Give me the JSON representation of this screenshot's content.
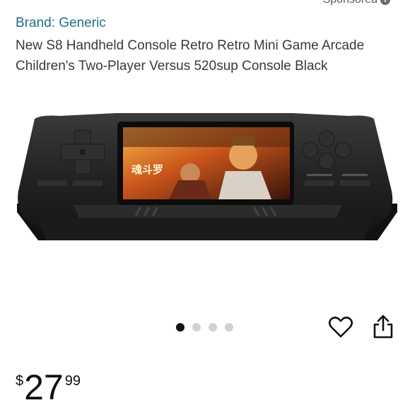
{
  "header": {
    "sponsored_label": "Sponsored",
    "sponsored_icon": "info-icon"
  },
  "product": {
    "brand": "Brand: Generic",
    "title": "New S8 Handheld Console Retro Retro Mini Game Arcade Children's Two-Player Versus 520sup Console Black",
    "image_icon": "handheld-console-image",
    "screen_text": "魂斗罗"
  },
  "carousel": {
    "total": 4,
    "active_index": 0
  },
  "actions": {
    "favorite_icon": "heart-icon",
    "share_icon": "share-icon"
  },
  "price": {
    "symbol": "$",
    "whole": "27",
    "fraction": "99"
  },
  "colors": {
    "brand_link": "#1f6f88",
    "text": "#0f1111",
    "dot_active": "#111111",
    "dot_inactive": "#cfd2d2"
  }
}
